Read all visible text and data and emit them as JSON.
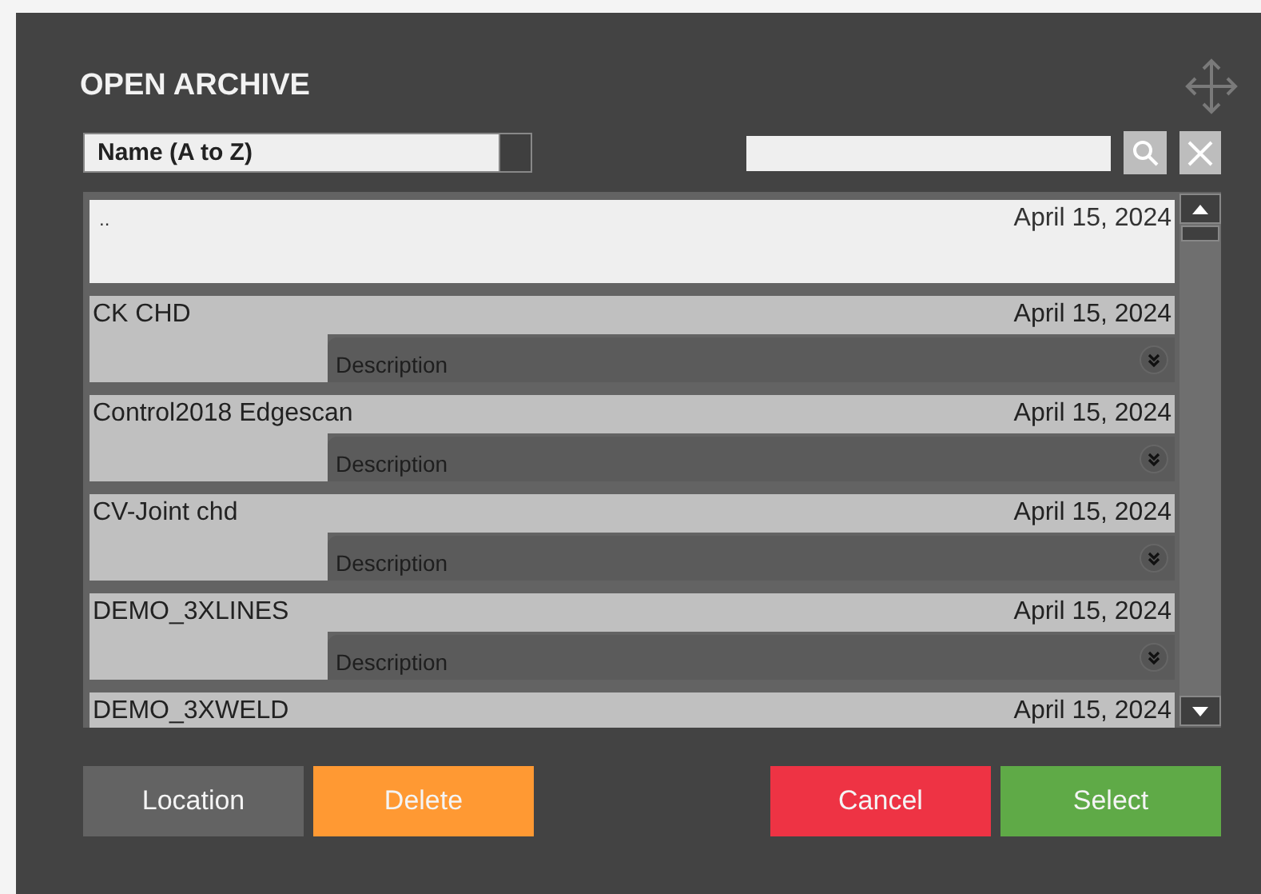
{
  "dialog": {
    "title": "OPEN ARCHIVE"
  },
  "sort": {
    "value": "Name (A to Z)"
  },
  "files": [
    {
      "name": "..",
      "date": "April 15, 2024",
      "selected": true
    },
    {
      "name": "CK CHD",
      "date": "April 15, 2024",
      "selected": false,
      "description": "Description"
    },
    {
      "name": "Control2018 Edgescan",
      "date": "April 15, 2024",
      "selected": false,
      "description": "Description"
    },
    {
      "name": "CV-Joint chd",
      "date": "April 15, 2024",
      "selected": false,
      "description": "Description"
    },
    {
      "name": "DEMO_3XLINES",
      "date": "April 15, 2024",
      "selected": false,
      "description": "Description"
    },
    {
      "name": "DEMO_3XWELD",
      "date": "April 15, 2024",
      "selected": false
    }
  ],
  "buttons": [
    {
      "label": "Location",
      "kind": "neutral"
    },
    {
      "label": "Delete",
      "kind": "warning"
    },
    {
      "label": "Cancel",
      "kind": "danger"
    },
    {
      "label": "Select",
      "kind": "confirm"
    }
  ]
}
